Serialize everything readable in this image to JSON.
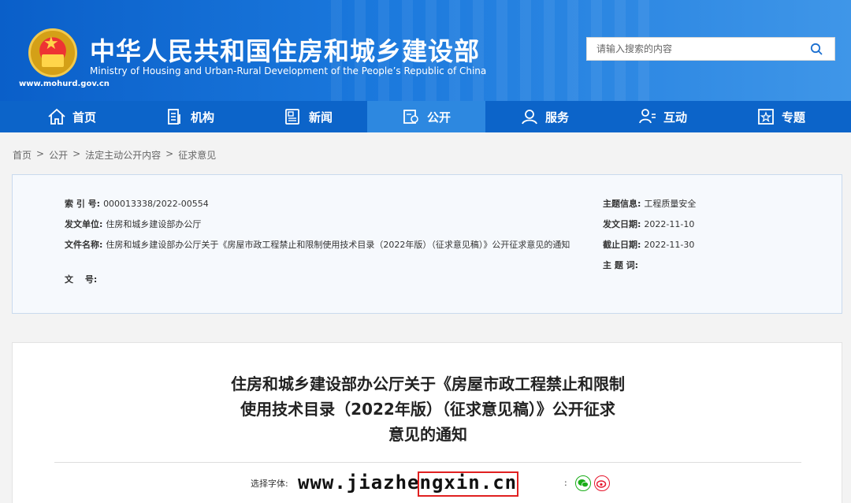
{
  "header": {
    "title": "中华人民共和国住房和城乡建设部",
    "subtitle": "Ministry of Housing and Urban-Rural Development of the People’s Republic of China",
    "site_url": "www.mohurd.gov.cn",
    "search_placeholder": "请输入搜索的内容",
    "emblem_icon": "national-emblem-icon",
    "search_icon": "search-icon",
    "brand_color": "#0c64c9"
  },
  "nav": {
    "items": [
      {
        "label": "首页",
        "icon": "home-icon"
      },
      {
        "label": "机构",
        "icon": "building-icon"
      },
      {
        "label": "新闻",
        "icon": "news-icon"
      },
      {
        "label": "公开",
        "icon": "public-icon",
        "active": true
      },
      {
        "label": "服务",
        "icon": "service-icon"
      },
      {
        "label": "互动",
        "icon": "interact-icon"
      },
      {
        "label": "专题",
        "icon": "topic-icon"
      }
    ]
  },
  "breadcrumb": [
    "首页",
    "公开",
    "法定主动公开内容",
    "征求意见"
  ],
  "breadcrumb_sep": ">",
  "meta": {
    "index_label": "索 引 号:",
    "index_value": "000013338/2022-00554",
    "issuer_label": "发文单位:",
    "issuer_value": "住房和城乡建设部办公厅",
    "docname_label": "文件名称:",
    "docname_value": "住房和城乡建设部办公厅关于《房屋市政工程禁止和限制使用技术目录（2022年版）（征求意见稿）》公开征求意见的通知",
    "docno_label": "文　 号:",
    "docno_value": "",
    "topic_label": "主题信息:",
    "topic_value": "工程质量安全",
    "date_label": "发文日期:",
    "date_value": "2022-11-10",
    "deadline_label": "截止日期:",
    "deadline_value": "2022-11-30",
    "keyword_label": "主 题 词:",
    "keyword_value": ""
  },
  "article": {
    "title_line1": "住房和城乡建设部办公厅关于《房屋市政工程禁止和限制",
    "title_line2": "使用技术目录（2022年版）（征求意见稿）》公开征求",
    "title_line3": "意见的通知",
    "font_select_label": "选择字体:",
    "share_label": ":"
  },
  "watermark": "www.jiazhengxin.cn"
}
